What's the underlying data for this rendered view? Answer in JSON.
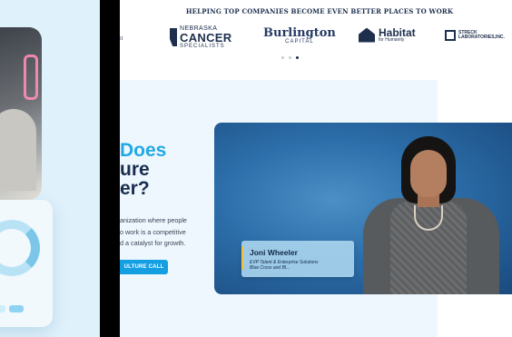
{
  "header": {
    "title": "HELPING TOP COMPANIES BECOME EVEN BETTER PLACES TO WORK",
    "partial_logo": "ıt",
    "logos": [
      {
        "line1": "NEBRASKA",
        "line2": "CANCER",
        "line3": "SPECIALISTS"
      },
      {
        "line1": "Burlington",
        "line2": "CAPITAL"
      },
      {
        "line1": "Habitat",
        "line2": "for Humanity"
      },
      {
        "line1": "STRECK",
        "line2": "LABORATORIES,INC."
      }
    ],
    "carousel_active_index": 2
  },
  "hero": {
    "heading_line1": "Does",
    "heading_line2": "ure",
    "heading_line3": "er?",
    "body_line1": "anization where people",
    "body_line2": "o work is a competitive",
    "body_line3": "d a catalyst for growth.",
    "cta_label": "ULTURE CALL"
  },
  "video": {
    "name": "Joni Wheeler",
    "title_line1": "EVP Talent & Enterprise Solutions",
    "title_line2": "Blue Cross and Bl..."
  },
  "colors": {
    "navy": "#1a2d4f",
    "accent_blue": "#22a9e6",
    "cta_blue": "#149fe3",
    "section_bg": "#eef7fd",
    "name_card_bar": "#f5c23e"
  }
}
